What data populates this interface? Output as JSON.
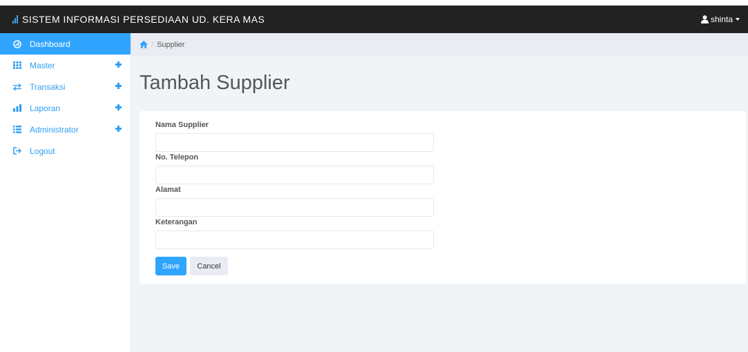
{
  "navbar": {
    "title": "SISTEM INFORMASI PERSEDIAAN UD. KERA MAS",
    "brand_icon": "signal-bars-icon",
    "user": "shinta",
    "user_icon": "user-icon"
  },
  "sidebar": {
    "items": [
      {
        "label": "Dashboard",
        "icon": "dashboard-icon",
        "active": true,
        "expandable": false
      },
      {
        "label": "Master",
        "icon": "grid-icon",
        "active": false,
        "expandable": true
      },
      {
        "label": "Transaksi",
        "icon": "transfer-icon",
        "active": false,
        "expandable": true
      },
      {
        "label": "Laporan",
        "icon": "stats-icon",
        "active": false,
        "expandable": true
      },
      {
        "label": "Administrator",
        "icon": "list-icon",
        "active": false,
        "expandable": true
      },
      {
        "label": "Logout",
        "icon": "logout-icon",
        "active": false,
        "expandable": false
      }
    ]
  },
  "breadcrumb": {
    "home_icon": "home-icon",
    "current": "Supplier"
  },
  "page": {
    "title": "Tambah Supplier"
  },
  "form": {
    "fields": [
      {
        "label": "Nama Supplier",
        "value": "",
        "placeholder": ""
      },
      {
        "label": "No. Telepon",
        "value": "",
        "placeholder": ""
      },
      {
        "label": "Alamat",
        "value": "",
        "placeholder": ""
      },
      {
        "label": "Keterangan",
        "value": "",
        "placeholder": ""
      }
    ],
    "save_label": "Save",
    "cancel_label": "Cancel"
  },
  "colors": {
    "navbar_bg": "#222222",
    "accent": "#30a5ff",
    "main_bg": "#f1f4f7",
    "breadcrumb_bg": "#e9ecf2"
  }
}
